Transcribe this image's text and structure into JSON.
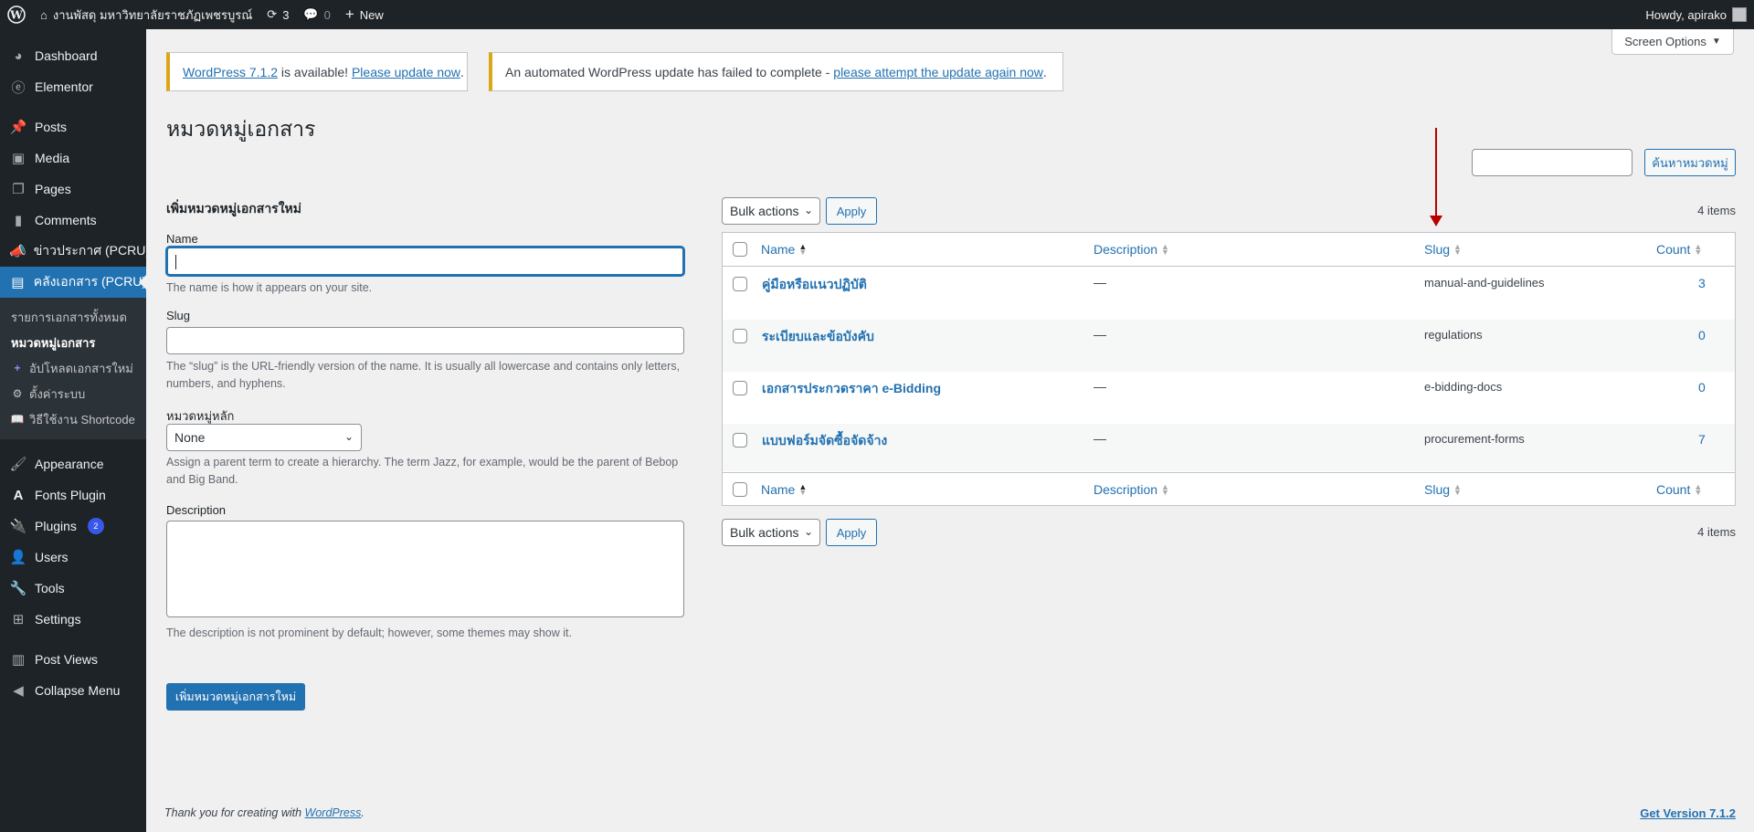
{
  "adminbar": {
    "site_name": "งานพัสดุ มหาวิทยาลัยราชภัฏเพชรบูรณ์",
    "updates_count": "3",
    "comments_count": "0",
    "new_label": "New",
    "howdy": "Howdy, apirako"
  },
  "sidebar": {
    "items": [
      {
        "label": "Dashboard",
        "icon": "dashboard-icon"
      },
      {
        "label": "Elementor",
        "icon": "elementor-icon"
      },
      {
        "label": "Posts",
        "icon": "pin-icon"
      },
      {
        "label": "Media",
        "icon": "media-icon"
      },
      {
        "label": "Pages",
        "icon": "pages-icon"
      },
      {
        "label": "Comments",
        "icon": "comment-icon"
      },
      {
        "label": "ข่าวประกาศ (PCRU)",
        "icon": "megaphone-icon"
      },
      {
        "label": "คลังเอกสาร (PCRU)",
        "icon": "document-icon"
      },
      {
        "label": "Appearance",
        "icon": "brush-icon"
      },
      {
        "label": "Fonts Plugin",
        "icon": "font-icon"
      },
      {
        "label": "Plugins",
        "icon": "plugin-icon",
        "badge": "2"
      },
      {
        "label": "Users",
        "icon": "user-icon"
      },
      {
        "label": "Tools",
        "icon": "wrench-icon"
      },
      {
        "label": "Settings",
        "icon": "settings-icon"
      },
      {
        "label": "Post Views",
        "icon": "bar-chart-icon"
      },
      {
        "label": "Collapse Menu",
        "icon": "collapse-icon"
      }
    ],
    "submenu": [
      {
        "label": "รายการเอกสารทั้งหมด"
      },
      {
        "label": "หมวดหมู่เอกสาร"
      },
      {
        "label": "อัปโหลดเอกสารใหม่",
        "icon": "+"
      },
      {
        "label": "ตั้งค่าระบบ",
        "icon": "⚙"
      },
      {
        "label": "วิธีใช้งาน Shortcode",
        "icon": "📖"
      }
    ]
  },
  "screen_options": "Screen Options",
  "notices": {
    "update_link": "WordPress 7.1.2",
    "update_text": " is available! ",
    "update_now": "Please update now",
    "failed_text": "An automated WordPress update has failed to complete - ",
    "failed_link": "please attempt the update again now"
  },
  "page_title": "หมวดหมู่เอกสาร",
  "search_button": "ค้นหาหมวดหมู่",
  "form": {
    "title": "เพิ่มหมวดหมู่เอกสารใหม่",
    "name_label": "Name",
    "name_help": "The name is how it appears on your site.",
    "slug_label": "Slug",
    "slug_help": "The “slug” is the URL-friendly version of the name. It is usually all lowercase and contains only letters, numbers, and hyphens.",
    "parent_label": "หมวดหมู่หลัก",
    "parent_value": "None",
    "parent_help": "Assign a parent term to create a hierarchy. The term Jazz, for example, would be the parent of Bebop and Big Band.",
    "description_label": "Description",
    "description_help": "The description is not prominent by default; however, some themes may show it.",
    "submit": "เพิ่มหมวดหมู่เอกสารใหม่"
  },
  "table": {
    "bulk_actions": "Bulk actions",
    "apply": "Apply",
    "items_count": "4 items",
    "columns": {
      "name": "Name",
      "description": "Description",
      "slug": "Slug",
      "count": "Count"
    },
    "rows": [
      {
        "name": "คู่มือหรือแนวปฏิบัติ",
        "description": "—",
        "slug": "manual-and-guidelines",
        "count": "3"
      },
      {
        "name": "ระเบียบและข้อบังคับ",
        "description": "—",
        "slug": "regulations",
        "count": "0"
      },
      {
        "name": "เอกสารประกวดราคา e-Bidding",
        "description": "—",
        "slug": "e-bidding-docs",
        "count": "0"
      },
      {
        "name": "แบบฟอร์มจัดซื้อจัดจ้าง",
        "description": "—",
        "slug": "procurement-forms",
        "count": "7"
      }
    ]
  },
  "footer": {
    "thanks_prefix": "Thank you for creating with ",
    "thanks_link": "WordPress",
    "thanks_suffix": ".",
    "version": "Get Version 7.1.2"
  },
  "colors": {
    "accent": "#2271b1",
    "adminbar": "#1d2327",
    "notice": "#dba617",
    "arrow": "#b80000"
  }
}
